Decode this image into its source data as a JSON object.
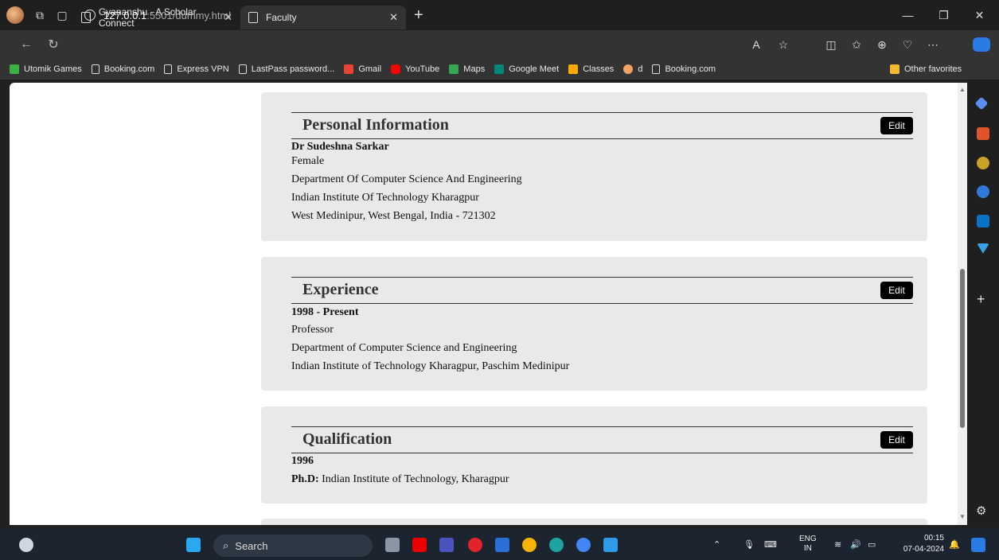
{
  "browser": {
    "tabs": [
      {
        "title": "Gyananshu - A Scholar Connect",
        "active": false
      },
      {
        "title": "Faculty",
        "active": true
      }
    ],
    "url_host": "127.0.0.1",
    "url_path": ":5501/dummy.html",
    "bookmarks": [
      {
        "label": "Utomik Games",
        "icon": "utomik-icon",
        "color": "#3cb043"
      },
      {
        "label": "Booking.com",
        "icon": "page-icon",
        "color": ""
      },
      {
        "label": "Express VPN",
        "icon": "page-icon",
        "color": ""
      },
      {
        "label": "LastPass password...",
        "icon": "page-icon",
        "color": ""
      },
      {
        "label": "Gmail",
        "icon": "gmail-icon",
        "color": "#ea4335"
      },
      {
        "label": "YouTube",
        "icon": "youtube-icon",
        "color": "#ff0000"
      },
      {
        "label": "Maps",
        "icon": "maps-icon",
        "color": "#34a853"
      },
      {
        "label": "Google Meet",
        "icon": "meet-icon",
        "color": "#00897b"
      },
      {
        "label": "Classes",
        "icon": "classroom-icon",
        "color": "#f9ab00"
      },
      {
        "label": "d",
        "icon": "d-icon",
        "color": "#f4a261"
      },
      {
        "label": "Booking.com",
        "icon": "page-icon",
        "color": ""
      }
    ],
    "other_favorites": "Other favorites"
  },
  "cards": {
    "personal": {
      "title": "Personal Information",
      "edit": "Edit",
      "name": "Dr Sudeshna Sarkar",
      "gender": "Female",
      "department": "Department Of Computer Science And Engineering",
      "institute": "Indian Institute Of Technology Kharagpur",
      "address": "West Medinipur, West Bengal, India - 721302"
    },
    "experience": {
      "title": "Experience",
      "edit": "Edit",
      "period": "1998 - Present",
      "role": "Professor",
      "department": "Department of Computer Science and Engineering",
      "institute": "Indian Institute of Technology Kharagpur, Paschim Medinipur"
    },
    "qualification": {
      "title": "Qualification",
      "edit": "Edit",
      "year": "1996",
      "degree": "Ph.D:",
      "institute": " Indian Institute of Technology, Kharagpur"
    }
  },
  "taskbar": {
    "search": "Search",
    "lang_top": "ENG",
    "lang_bottom": "IN",
    "time": "00:15",
    "date": "07-04-2024"
  },
  "colors": {
    "card_bg": "#e9e9e9",
    "edit_bg": "#000000",
    "browser_chrome": "#333333",
    "taskbar": "#1c2430"
  }
}
